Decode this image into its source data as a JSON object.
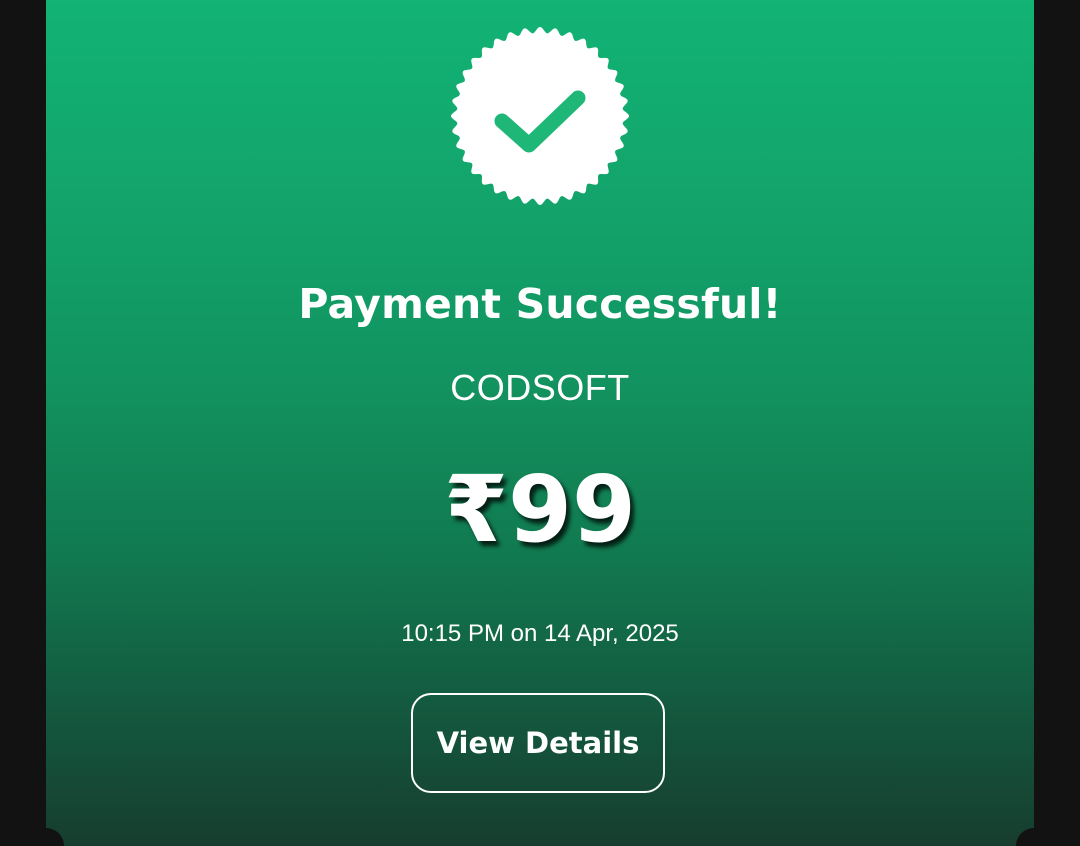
{
  "payment": {
    "title": "Payment Successful!",
    "merchant": "CODSOFT",
    "amount": "₹99",
    "timestamp": "10:15 PM on 14 Apr, 2025",
    "view_details_label": "View Details"
  },
  "icons": {
    "success_badge": "verified-check-badge-icon"
  },
  "colors": {
    "gradient_top": "#12b374",
    "gradient_bottom": "#173d2e",
    "check_green": "#1fb777",
    "text": "#ffffff",
    "background": "#121212"
  }
}
